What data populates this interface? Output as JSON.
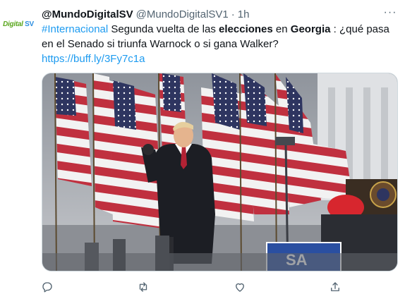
{
  "tweet": {
    "avatar_text_a": "Digital",
    "avatar_text_b": "SV",
    "display_name": "@MundoDigitalSV",
    "handle": "@MundoDigitalSV1",
    "separator": "·",
    "time": "1h",
    "more": "···",
    "text": {
      "hashtag": "#Internacional",
      "part1": " Segunda vuelta de las ",
      "bold1": "elecciones",
      "part2": " en ",
      "bold2": "Georgia",
      "part3": " : ¿qué pasa en el Senado si triunfa Warnock o si gana Walker?",
      "link": "https://buff.ly/3Fy7c1a"
    },
    "media": {
      "sign_text": "SA"
    },
    "actions": [
      "reply-icon",
      "retweet-icon",
      "like-icon",
      "share-icon"
    ]
  },
  "colors": {
    "accent": "#1d9bf0",
    "text": "#0f1419",
    "secondary": "#536471",
    "flag_red": "#b22234",
    "flag_blue": "#3c3b6e"
  }
}
